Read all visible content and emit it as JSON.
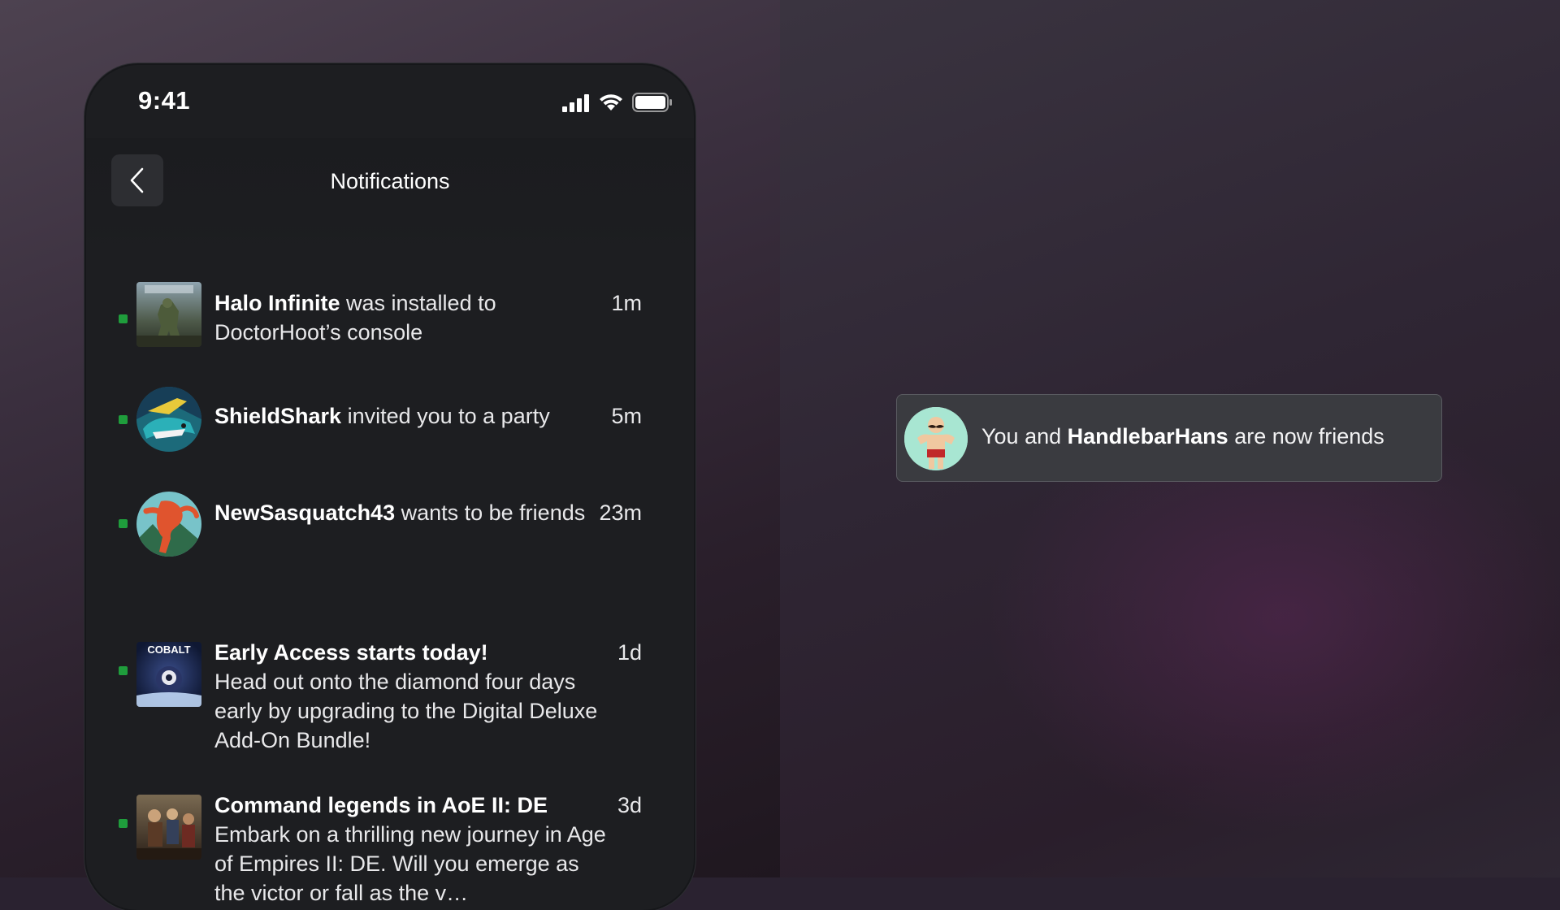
{
  "status_bar": {
    "time": "9:41"
  },
  "header": {
    "title": "Notifications"
  },
  "notifications": [
    {
      "bold": "Halo Infinite",
      "text": " was installed to DoctorHoot’s console",
      "time": "1m",
      "unread": true,
      "thumbnail": "halo-infinite-thumbnail"
    },
    {
      "bold": "ShieldShark",
      "text": " invited you to a party",
      "time": "5m",
      "unread": true,
      "thumbnail": "shieldshark-avatar"
    },
    {
      "bold": "NewSasquatch43",
      "text": " wants to be friends",
      "time": "23m",
      "unread": true,
      "thumbnail": "newsasquatch43-avatar"
    },
    {
      "bold": "Early Access starts today!",
      "text": "Head out onto the diamond four days early by upgrading to the Digital Deluxe Add-On Bundle!",
      "time": "1d",
      "unread": true,
      "thumbnail": "cobalt-thumbnail",
      "thumbnail_label": "COBALT"
    },
    {
      "bold": "Command legends in AoE II: DE",
      "text": "Embark on a thrilling new journey in Age of Empires II: DE. Will you emerge as the victor or fall as the v…",
      "time": "3d",
      "unread": true,
      "thumbnail": "aoe2-thumbnail"
    }
  ],
  "toast": {
    "prefix": "You and ",
    "bold": "HandlebarHans",
    "suffix": " are now friends"
  },
  "colors": {
    "unread_dot": "#1f9d3c",
    "panel": "#1d1e21",
    "toast": "#3a3b40"
  }
}
